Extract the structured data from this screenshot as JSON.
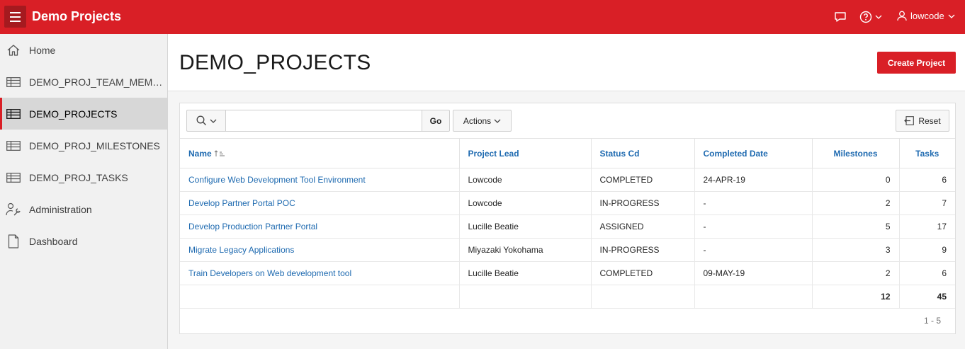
{
  "header": {
    "app_title": "Demo Projects",
    "user": "lowcode",
    "icons": [
      "menu-icon",
      "chat-icon",
      "help-icon",
      "user-icon"
    ]
  },
  "sidebar": {
    "items": [
      {
        "label": "Home",
        "icon": "home-icon"
      },
      {
        "label": "DEMO_PROJ_TEAM_MEMBERS",
        "icon": "table-icon"
      },
      {
        "label": "DEMO_PROJECTS",
        "icon": "table-icon",
        "active": true
      },
      {
        "label": "DEMO_PROJ_MILESTONES",
        "icon": "table-icon"
      },
      {
        "label": "DEMO_PROJ_TASKS",
        "icon": "table-icon"
      },
      {
        "label": "Administration",
        "icon": "admin-icon"
      },
      {
        "label": "Dashboard",
        "icon": "document-icon"
      }
    ]
  },
  "main": {
    "title": "DEMO_PROJECTS",
    "create_button": "Create Project",
    "toolbar": {
      "search_value": "",
      "go_label": "Go",
      "actions_label": "Actions",
      "reset_label": "Reset"
    },
    "table": {
      "columns": [
        "Name",
        "Project Lead",
        "Status Cd",
        "Completed Date",
        "Milestones",
        "Tasks"
      ],
      "rows": [
        [
          "Configure Web Development Tool Environment",
          "Lowcode",
          "COMPLETED",
          "24-APR-19",
          "0",
          "6"
        ],
        [
          "Develop Partner Portal POC",
          "Lowcode",
          "IN-PROGRESS",
          "-",
          "2",
          "7"
        ],
        [
          "Develop Production Partner Portal",
          "Lucille Beatie",
          "ASSIGNED",
          "-",
          "5",
          "17"
        ],
        [
          "Migrate Legacy Applications",
          "Miyazaki Yokohama",
          "IN-PROGRESS",
          "-",
          "3",
          "9"
        ],
        [
          "Train Developers on Web development tool",
          "Lucille Beatie",
          "COMPLETED",
          "09-MAY-19",
          "2",
          "6"
        ]
      ],
      "totals": {
        "milestones": "12",
        "tasks": "45"
      },
      "pagination": "1 - 5"
    }
  },
  "colors": {
    "brand": "#d91f26",
    "link": "#1e6ab0"
  }
}
